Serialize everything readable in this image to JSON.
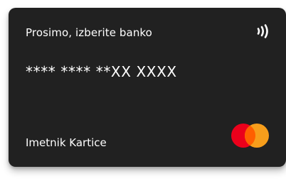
{
  "card": {
    "prompt": "Prosimo, izberite banko",
    "number": "**** **** **XX XXXX",
    "holder_label": "Imetnik Kartice",
    "contactless_icon": "contactless-icon",
    "network_logo": "mastercard-logo"
  },
  "colors": {
    "card_background": "#212121",
    "text": "#ffffff",
    "mastercard_red": "#eb001b",
    "mastercard_orange": "#f79e1b",
    "mastercard_overlap": "#ff5f00"
  }
}
